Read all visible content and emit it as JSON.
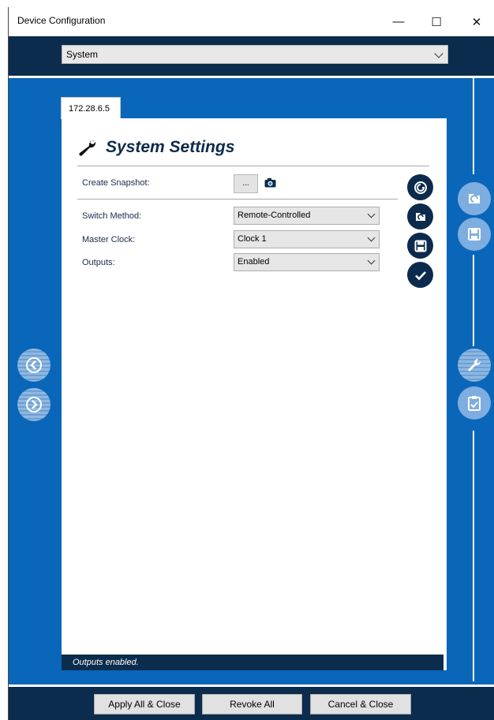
{
  "window": {
    "title": "Device Configuration",
    "minimize_glyph": "—",
    "maximize_glyph": "☐",
    "close_glyph": "✕"
  },
  "header": {
    "selector_value": "System"
  },
  "tab": {
    "label": "172.28.6.5"
  },
  "panel": {
    "title": "System Settings",
    "snapshot_label": "Create Snapshot:",
    "snapshot_button": "...",
    "fields": [
      {
        "label": "Switch Method:",
        "value": "Remote-Controlled"
      },
      {
        "label": "Master Clock:",
        "value": "Clock 1"
      },
      {
        "label": "Outputs:",
        "value": "Enabled"
      }
    ],
    "status": "Outputs enabled."
  },
  "footer": {
    "apply_label": "Apply All & Close",
    "revoke_label": "Revoke All",
    "cancel_label": "Cancel & Close"
  },
  "colors": {
    "navy": "#0b2c4d",
    "blue": "#0a66b8",
    "panel": "#ffffff"
  }
}
